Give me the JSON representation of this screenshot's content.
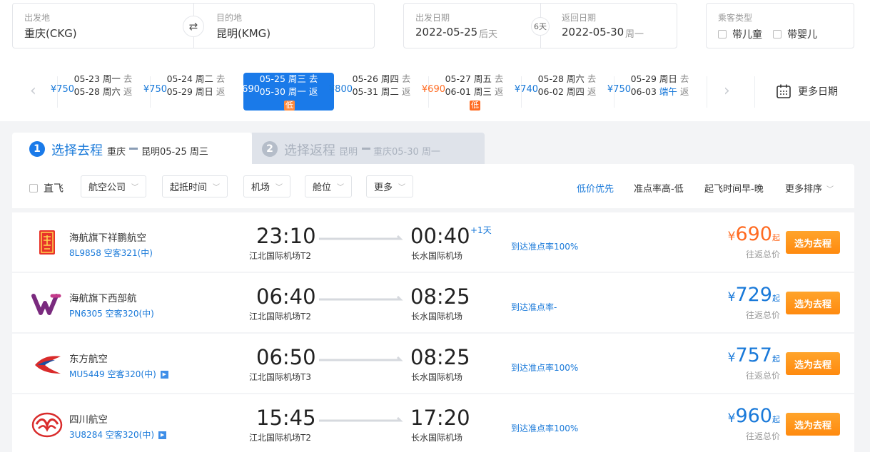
{
  "search": {
    "origin_label": "出发地",
    "origin_value": "重庆(CKG)",
    "dest_label": "目的地",
    "dest_value": "昆明(KMG)",
    "depart_label": "出发日期",
    "depart_date": "2022-05-25",
    "depart_day": "后天",
    "duration": "6天",
    "return_label": "返回日期",
    "return_date": "2022-05-30",
    "return_day": "周一",
    "passenger_label": "乘客类型",
    "child_label": "带儿童",
    "infant_label": "带婴儿"
  },
  "dates": [
    {
      "go": "05-23",
      "go_wd": "周一",
      "go_tag": "去",
      "back": "05-28",
      "back_wd": "周六",
      "back_tag": "返",
      "price": "¥750",
      "low": ""
    },
    {
      "go": "05-24",
      "go_wd": "周二",
      "go_tag": "去",
      "back": "05-29",
      "back_wd": "周日",
      "back_tag": "返",
      "price": "¥750",
      "low": ""
    },
    {
      "go": "05-25",
      "go_wd": "周三",
      "go_tag": "去",
      "back": "05-30",
      "back_wd": "周一",
      "back_tag": "返",
      "price": "¥690",
      "low": "低"
    },
    {
      "go": "05-26",
      "go_wd": "周四",
      "go_tag": "去",
      "back": "05-31",
      "back_wd": "周二",
      "back_tag": "返",
      "price": "¥800",
      "low": ""
    },
    {
      "go": "05-27",
      "go_wd": "周五",
      "go_tag": "去",
      "back": "06-01",
      "back_wd": "周三",
      "back_tag": "返",
      "price": "¥690",
      "low": "低"
    },
    {
      "go": "05-28",
      "go_wd": "周六",
      "go_tag": "去",
      "back": "06-02",
      "back_wd": "周四",
      "back_tag": "返",
      "price": "¥740",
      "low": ""
    },
    {
      "go": "05-29",
      "go_wd": "周日",
      "go_tag": "去",
      "back": "06-03",
      "back_wd": "端午",
      "back_tag": "返",
      "price": "¥750",
      "low": ""
    }
  ],
  "more_dates_label": "更多日期",
  "tabs": {
    "tab1_num": "1",
    "tab1_title": "选择去程",
    "tab1_from": "重庆",
    "tab1_to": "昆明05-25 周三",
    "tab2_num": "2",
    "tab2_title": "选择返程",
    "tab2_from": "昆明",
    "tab2_to": "重庆05-30 周一"
  },
  "filters": {
    "direct_label": "直飞",
    "airline_label": "航空公司",
    "time_label": "起抵时间",
    "airport_label": "机场",
    "cabin_label": "舱位",
    "more_label": "更多"
  },
  "sort": {
    "low_price": "低价优先",
    "punctuality": "准点率高-低",
    "dep_time": "起飞时间早-晚",
    "more": "更多排序"
  },
  "flights": [
    {
      "airline": "海航旗下祥鹏航空",
      "flight_no": "8L9858 空客321(中)",
      "dep_time": "23:10",
      "dep_airport": "江北国际机场T2",
      "arr_time": "00:40",
      "arr_airport": "长水国际机场",
      "plus_day": "+1天",
      "punctuality": "到达准点率100%",
      "yen": "¥",
      "price": "690",
      "qi": "起",
      "rt_label": "往返总价",
      "btn": "选为去程"
    },
    {
      "airline": "海航旗下西部航",
      "flight_no": "PN6305 空客320(中)",
      "dep_time": "06:40",
      "dep_airport": "江北国际机场T2",
      "arr_time": "08:25",
      "arr_airport": "长水国际机场",
      "plus_day": "",
      "punctuality": "到达准点率-",
      "yen": "¥",
      "price": "729",
      "qi": "起",
      "rt_label": "往返总价",
      "btn": "选为去程"
    },
    {
      "airline": "东方航空",
      "flight_no": "MU5449 空客320(中)",
      "dep_time": "06:50",
      "dep_airport": "江北国际机场T3",
      "arr_time": "08:25",
      "arr_airport": "长水国际机场",
      "plus_day": "",
      "punctuality": "到达准点率100%",
      "yen": "¥",
      "price": "757",
      "qi": "起",
      "rt_label": "往返总价",
      "btn": "选为去程"
    },
    {
      "airline": "四川航空",
      "flight_no": "3U8284 空客320(中)",
      "dep_time": "15:45",
      "dep_airport": "江北国际机场T2",
      "arr_time": "17:20",
      "arr_airport": "长水国际机场",
      "plus_day": "",
      "punctuality": "到达准点率100%",
      "yen": "¥",
      "price": "960",
      "qi": "起",
      "rt_label": "往返总价",
      "btn": "选为去程"
    }
  ],
  "colors": {
    "accent": "#1a7ae9",
    "price_blue": "#1979d9",
    "price_orange": "#ff6b22",
    "button_orange": "#ff8a0f"
  }
}
